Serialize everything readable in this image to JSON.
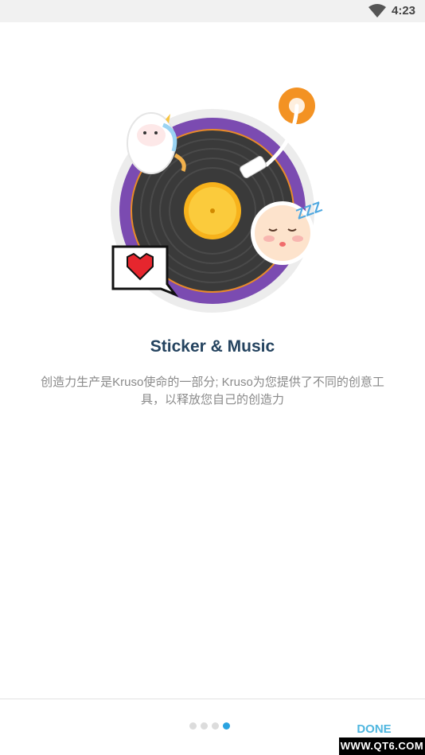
{
  "status_bar": {
    "time": "4:23",
    "wifi_icon": "wifi-icon"
  },
  "slide": {
    "title": "Sticker & Music",
    "description": "创造力生产是Kruso使命的一部分; Kruso为您提供了不同的创意工具，以释放您自己的创造力",
    "illustration_icons": [
      "vinyl-record-icon",
      "unicorn-sticker-icon",
      "baby-sleeping-sticker-icon",
      "pixel-heart-bubble-icon",
      "tonearm-icon"
    ],
    "sleep_text": "ZZZ"
  },
  "pager": {
    "total": 4,
    "current": 4
  },
  "footer": {
    "done_label": "DONE"
  },
  "watermark": "WWW.QT6.COM",
  "colors": {
    "title": "#24435f",
    "accent": "#4fb6df",
    "active_dot": "#2aa3e0",
    "record_ring": "#7b4bb1",
    "record_label": "#f7b21c",
    "tonearm_base": "#f39223"
  }
}
